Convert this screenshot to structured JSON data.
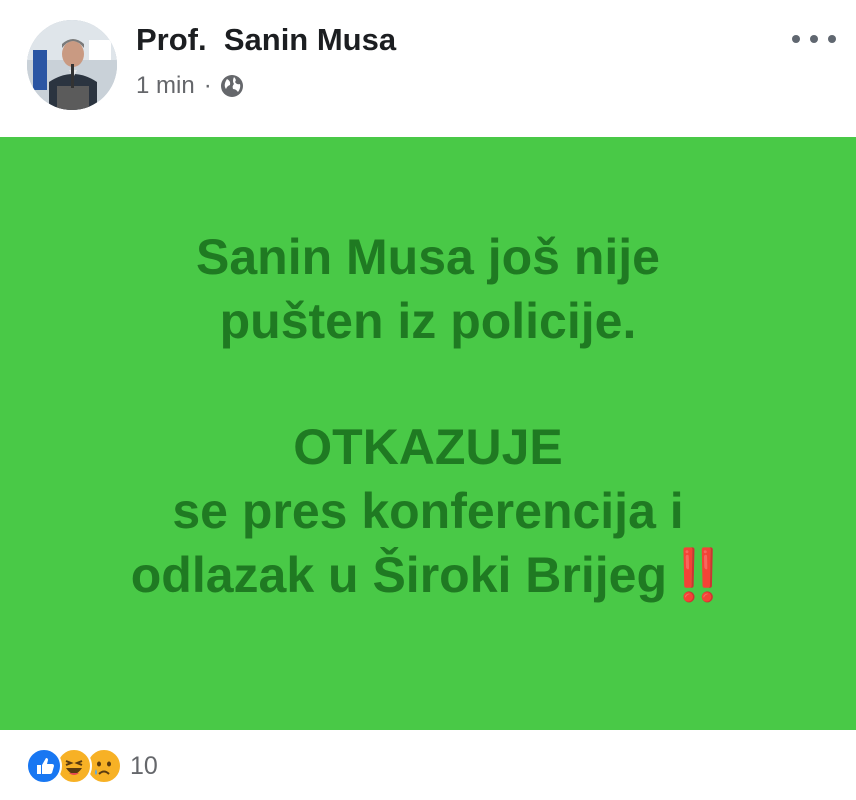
{
  "post": {
    "author": "Prof.  Sanin Musa",
    "timestamp": "1 min",
    "separator": "·",
    "privacy_icon": "globe-icon",
    "more_icon": "more-options-icon",
    "body_background": "#49c947",
    "body_text_color": "#1f7a22",
    "text_lines": [
      "Sanin Musa još nije",
      "pušten iz policije.",
      "OTKAZUJE",
      "se pres konferencija i",
      "odlazak u Široki Brijeg"
    ],
    "emoji_suffix": "‼️"
  },
  "reactions": {
    "icons": [
      "like-icon",
      "haha-icon",
      "sad-icon"
    ],
    "count": "10"
  }
}
